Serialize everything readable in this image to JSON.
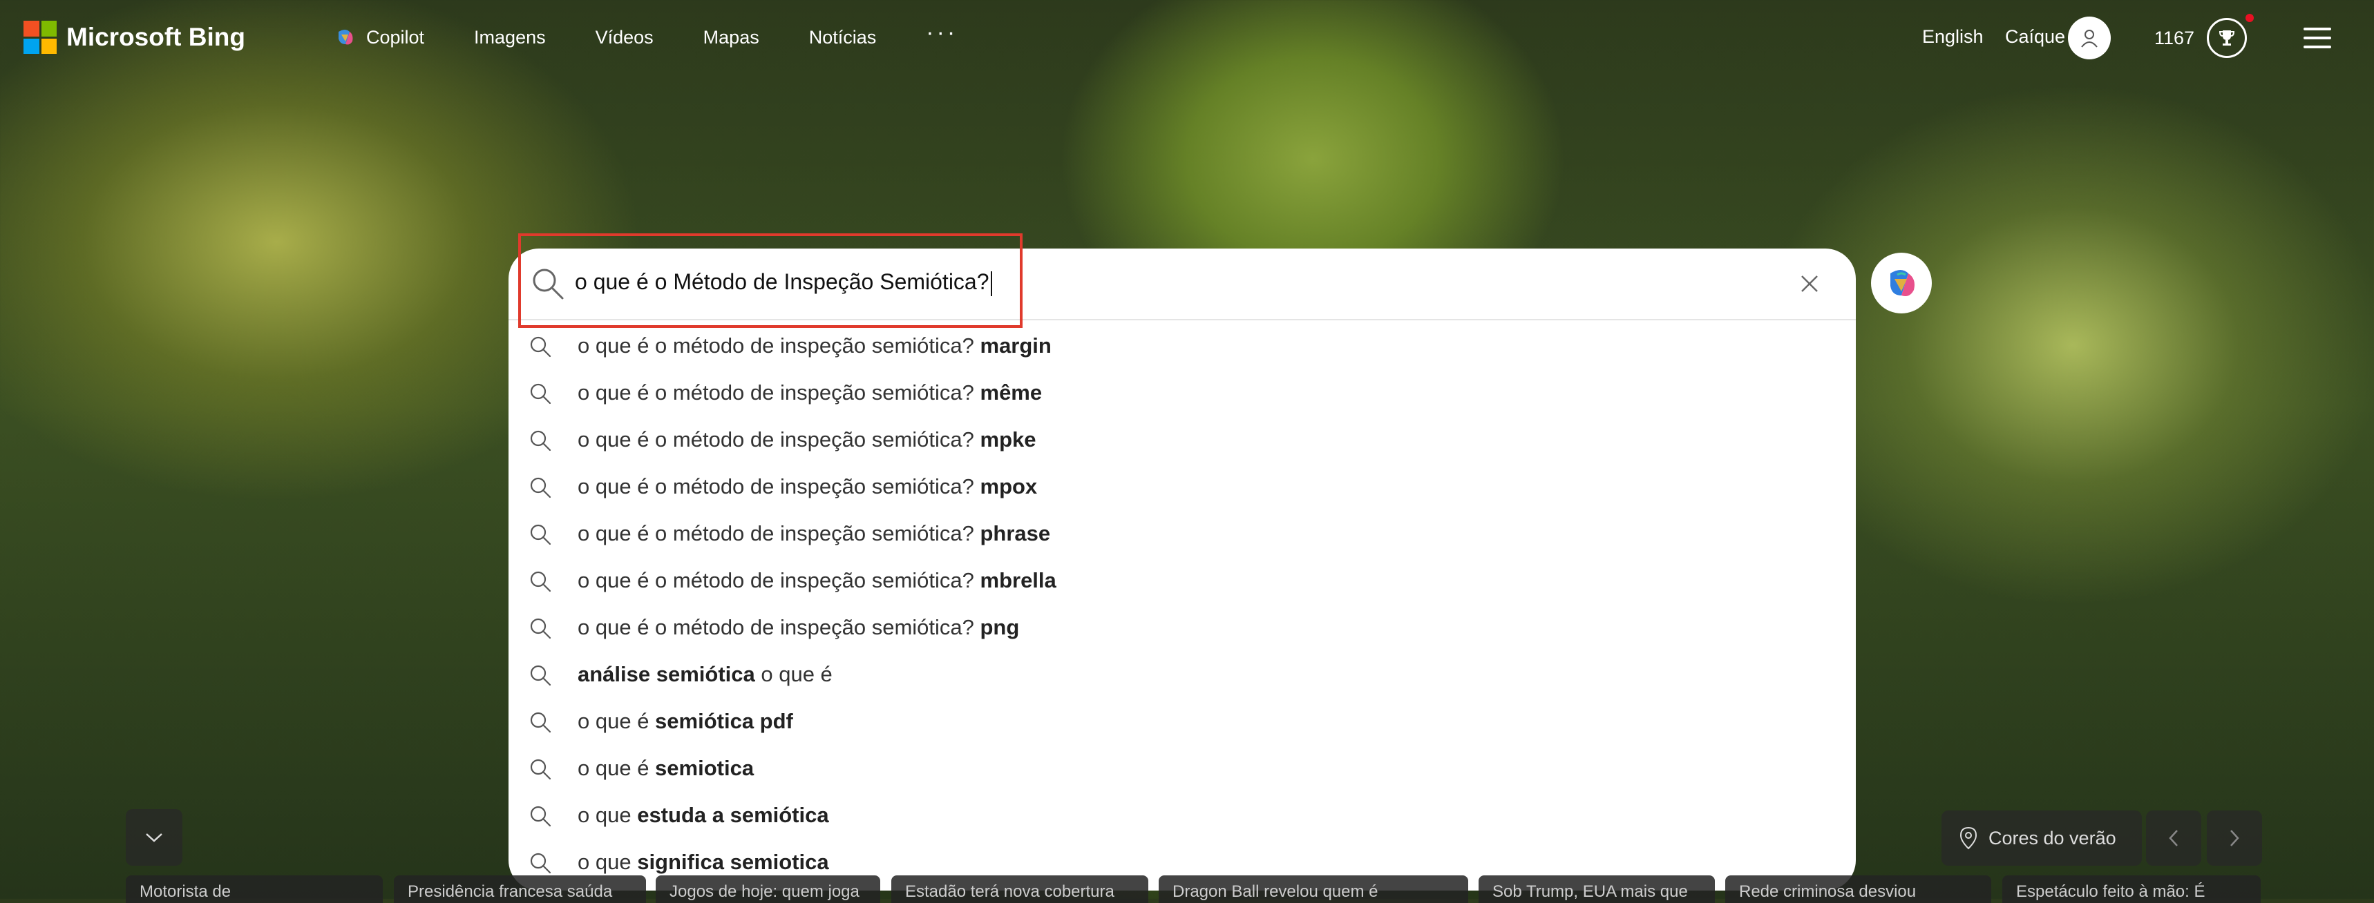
{
  "header": {
    "brand": "Microsoft Bing",
    "nav": [
      "Copilot",
      "Imagens",
      "Vídeos",
      "Mapas",
      "Notícias"
    ],
    "more": "···",
    "language": "English",
    "user_name": "Caíque",
    "points": "1167"
  },
  "search": {
    "query": "o que é o Método de Inspeção Semiótica?",
    "suggestions": [
      {
        "normal": "o que é o método de inspeção semiótica? ",
        "bold": "margin",
        "after": ""
      },
      {
        "normal": "o que é o método de inspeção semiótica? ",
        "bold": "même",
        "after": ""
      },
      {
        "normal": "o que é o método de inspeção semiótica? ",
        "bold": "mpke",
        "after": ""
      },
      {
        "normal": "o que é o método de inspeção semiótica? ",
        "bold": "mpox",
        "after": ""
      },
      {
        "normal": "o que é o método de inspeção semiótica? ",
        "bold": "phrase",
        "after": ""
      },
      {
        "normal": "o que é o método de inspeção semiótica? ",
        "bold": "mbrella",
        "after": ""
      },
      {
        "normal": "o que é o método de inspeção semiótica? ",
        "bold": "png",
        "after": ""
      },
      {
        "normal": "",
        "bold": "análise semiótica",
        "after": " o que é"
      },
      {
        "normal": "o que é ",
        "bold": "semiótica pdf",
        "after": ""
      },
      {
        "normal": "o que é ",
        "bold": "semiotica",
        "after": ""
      },
      {
        "normal": "o que ",
        "bold": "estuda a semiótica",
        "after": ""
      },
      {
        "normal": "o que ",
        "bold": "significa semiotica",
        "after": ""
      }
    ]
  },
  "background": {
    "location_label": "Cores do verão"
  },
  "news": [
    "Motorista de",
    "Presidência francesa saúda",
    "Jogos de hoje: quem joga",
    "Estadão terá nova cobertura",
    "Dragon Ball revelou quem é",
    "Sob Trump, EUA mais que",
    "Rede criminosa desviou",
    "Espetáculo feito à mão: É"
  ],
  "colors": {
    "ms_red": "#f25022",
    "ms_green": "#7fba00",
    "ms_blue": "#00a4ef",
    "ms_yellow": "#ffb900",
    "highlight": "#e03a2c",
    "notification": "#e81123"
  },
  "icons": {
    "search": "search-icon",
    "clear": "close-icon",
    "copilot": "copilot-icon",
    "avatar": "user-icon",
    "trophy": "trophy-icon",
    "menu": "hamburger-icon",
    "pin": "location-pin-icon",
    "chevron_down": "chevron-down-icon",
    "chevron_left": "chevron-left-icon",
    "chevron_right": "chevron-right-icon"
  }
}
